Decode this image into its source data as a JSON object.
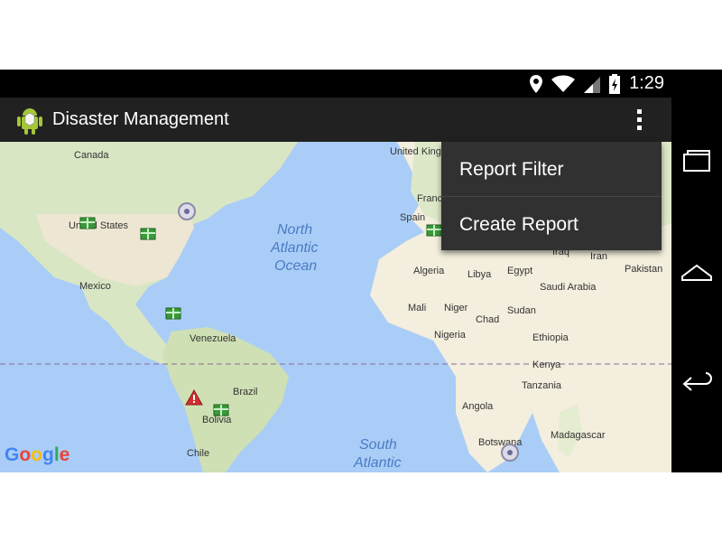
{
  "status_bar": {
    "time": "1:29"
  },
  "action_bar": {
    "title": "Disaster Management"
  },
  "menu": {
    "items": [
      {
        "label": "Report Filter"
      },
      {
        "label": "Create Report"
      }
    ]
  },
  "map": {
    "logo": "Google",
    "countries": [
      "Canada",
      "United States",
      "Mexico",
      "Venezuela",
      "Brazil",
      "Bolivia",
      "Chile",
      "United Kingdom",
      "France",
      "Spain",
      "Algeria",
      "Libya",
      "Egypt",
      "Mali",
      "Niger",
      "Chad",
      "Sudan",
      "Nigeria",
      "Ethiopia",
      "Kenya",
      "Tanzania",
      "Angola",
      "Botswana",
      "Madagascar",
      "Saudi Arabia",
      "Iran",
      "Iraq",
      "Pakistan"
    ],
    "oceans": {
      "north_atlantic": [
        "North",
        "Atlantic",
        "Ocean"
      ],
      "south_atlantic": [
        "South",
        "Atlantic"
      ]
    },
    "markers": [
      "gift-marker",
      "gift-marker",
      "gift-marker",
      "gift-marker",
      "gift-marker",
      "gift-marker",
      "shelter-marker",
      "shelter-marker",
      "warning-marker"
    ]
  }
}
